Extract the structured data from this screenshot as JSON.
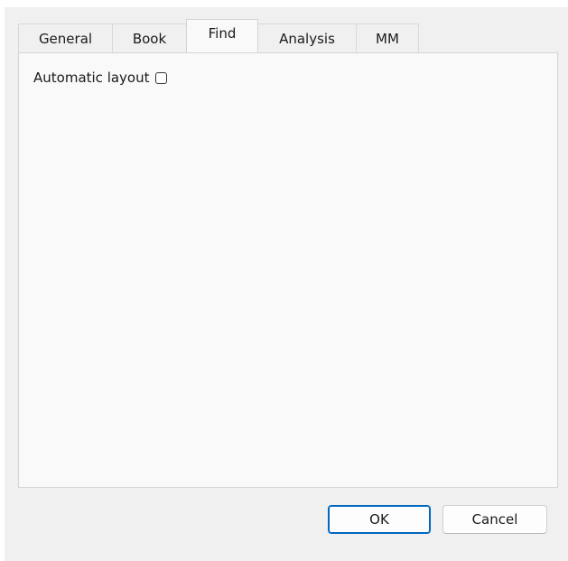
{
  "tabs": [
    {
      "label": "General",
      "active": false
    },
    {
      "label": "Book",
      "active": false
    },
    {
      "label": "Find",
      "active": true
    },
    {
      "label": "Analysis",
      "active": false
    },
    {
      "label": "MM",
      "active": false
    }
  ],
  "panel": {
    "auto_layout_label": "Automatic layout",
    "auto_layout_checked": false
  },
  "buttons": {
    "ok_label": "OK",
    "cancel_label": "Cancel"
  },
  "colors": {
    "dialog_bg": "#f0f0f0",
    "panel_bg": "#f9f9f9",
    "default_button_border": "#0067c0"
  }
}
